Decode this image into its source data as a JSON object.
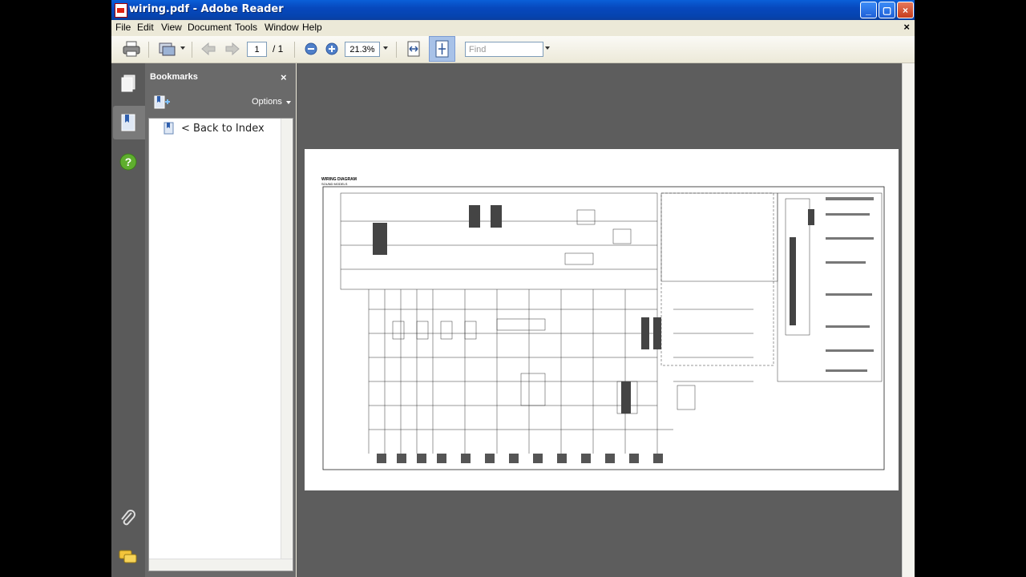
{
  "window": {
    "title": "wiring.pdf - Adobe Reader",
    "controls": {
      "minimize": "_",
      "maximize": "▢",
      "close": "×"
    }
  },
  "menu": {
    "items": [
      "File",
      "Edit",
      "View",
      "Document",
      "Tools",
      "Window",
      "Help"
    ],
    "close_label": "×"
  },
  "toolbar": {
    "page_current": "1",
    "page_total": "/ 1",
    "zoom": "21.3%",
    "find_placeholder": "Find"
  },
  "bookmarks": {
    "header": "Bookmarks",
    "close_label": "×",
    "options_label": "Options",
    "items": [
      {
        "label": "< Back to Index"
      }
    ]
  },
  "document": {
    "title_line1": "WIRING DIAGRAM",
    "title_line2": "SOUND MODELS"
  },
  "colors": {
    "titlebar": "#0748bd",
    "panel": "#6a6a6a",
    "doc_bg": "#5d5d5d",
    "nav_strip": "#5a5a5a"
  }
}
